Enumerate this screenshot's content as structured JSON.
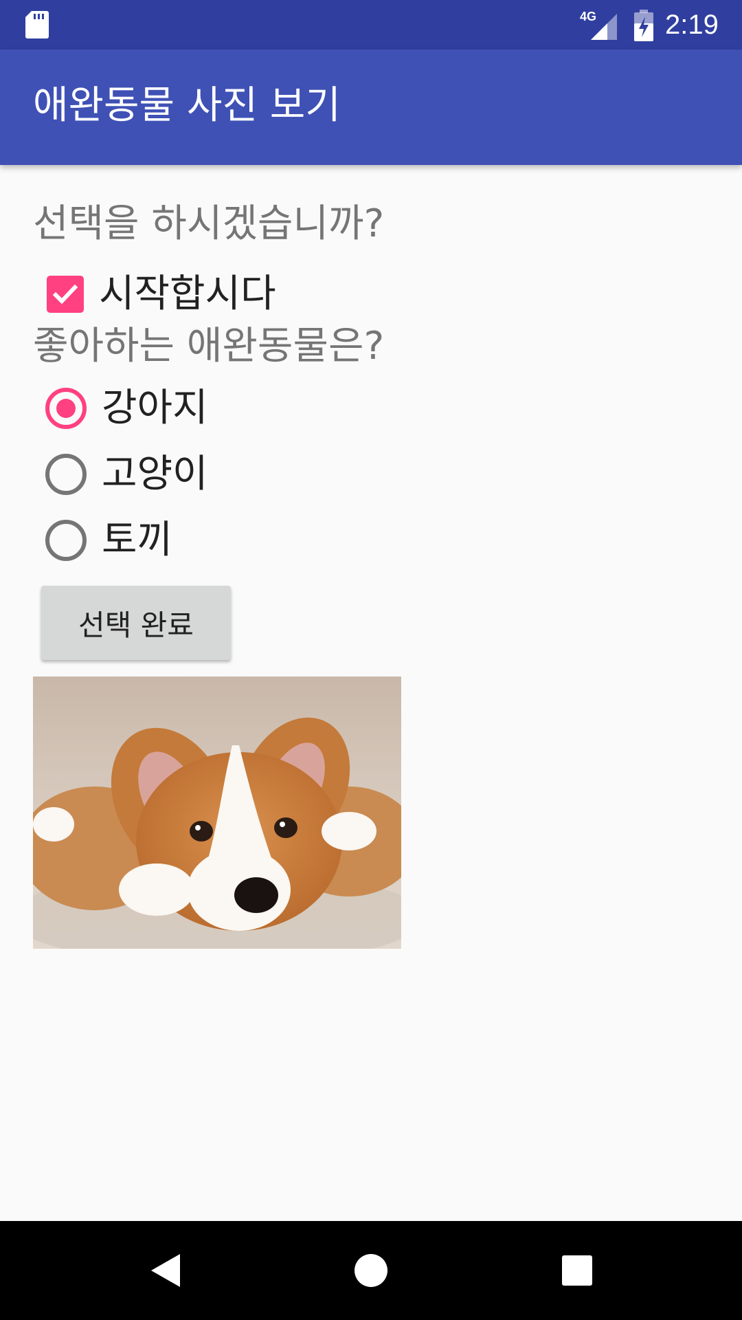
{
  "status_bar": {
    "time": "2:19",
    "network": "4G",
    "icons": [
      "sd-card-icon",
      "signal-icon",
      "battery-charging-icon"
    ]
  },
  "app_bar": {
    "title": "애완동물 사진 보기"
  },
  "main": {
    "question_start": "선택을 하시겠습니까?",
    "start_checkbox": {
      "label": "시작합시다",
      "checked": true
    },
    "question_pet": "좋아하는 애완동물은?",
    "pet_options": [
      {
        "label": "강아지",
        "selected": true
      },
      {
        "label": "고양이",
        "selected": false
      },
      {
        "label": "토끼",
        "selected": false
      }
    ],
    "done_button": "선택 완료",
    "photo_icon": "corgi-puppy-photo"
  },
  "nav_bar": {
    "icons": [
      "back-icon",
      "home-icon",
      "recents-icon"
    ]
  },
  "colors": {
    "status_bar": "#303f9f",
    "app_bar": "#3f51b5",
    "accent": "#ff4081",
    "background": "#fafafa",
    "secondary_text": "#757575"
  }
}
